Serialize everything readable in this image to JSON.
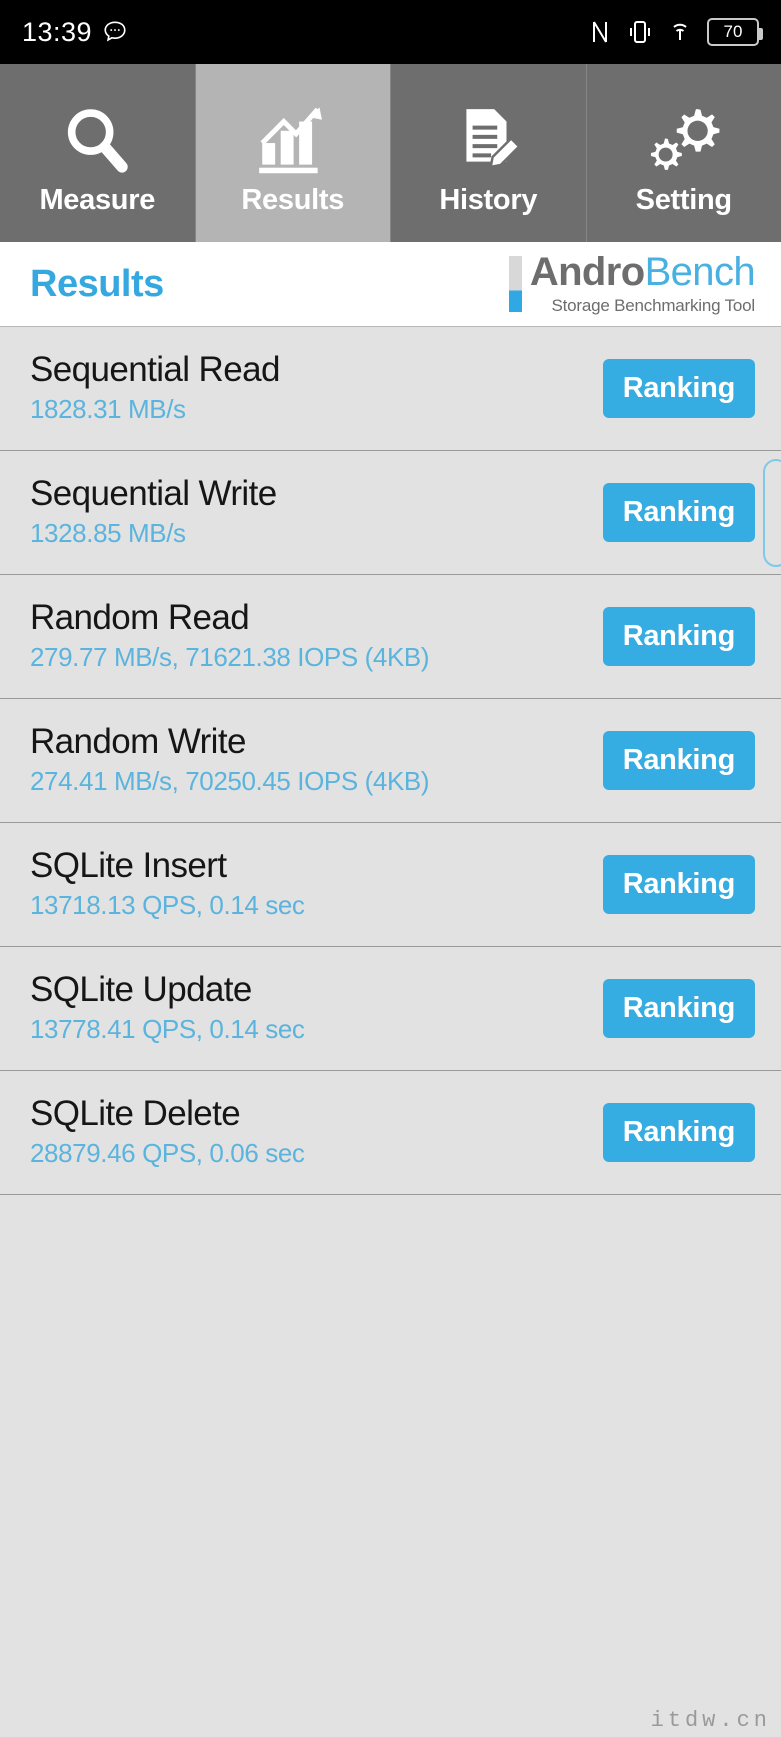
{
  "statusbar": {
    "time": "13:39",
    "message_icon": "message-icon",
    "nfc_icon": "nfc-icon",
    "vibrate_icon": "vibrate-icon",
    "wifi_icon": "wifi-icon",
    "battery_level": "70"
  },
  "tabs": [
    {
      "label": "Measure",
      "icon": "magnifier-icon",
      "active": false
    },
    {
      "label": "Results",
      "icon": "bar-chart-icon",
      "active": true
    },
    {
      "label": "History",
      "icon": "document-pencil-icon",
      "active": false
    },
    {
      "label": "Setting",
      "icon": "gears-icon",
      "active": false
    }
  ],
  "header": {
    "title": "Results",
    "brand_first": "Andro",
    "brand_second": "Bench",
    "brand_subtitle": "Storage Benchmarking Tool"
  },
  "results": {
    "ranking_label": "Ranking",
    "rows": [
      {
        "title": "Sequential Read",
        "value": "1828.31 MB/s"
      },
      {
        "title": "Sequential Write",
        "value": "1328.85 MB/s"
      },
      {
        "title": "Random Read",
        "value": "279.77 MB/s, 71621.38 IOPS (4KB)"
      },
      {
        "title": "Random Write",
        "value": "274.41 MB/s, 70250.45 IOPS (4KB)"
      },
      {
        "title": "SQLite Insert",
        "value": "13718.13 QPS, 0.14 sec"
      },
      {
        "title": "SQLite Update",
        "value": "13778.41 QPS, 0.14 sec"
      },
      {
        "title": "SQLite Delete",
        "value": "28879.46 QPS, 0.06 sec"
      }
    ]
  },
  "watermark": "itdw.cn",
  "colors": {
    "accent": "#35ace2",
    "value_text": "#5bb4dd",
    "tab_bg": "#6e6e6e",
    "tab_active_bg": "#b4b4b4",
    "list_bg": "#e2e2e2"
  }
}
